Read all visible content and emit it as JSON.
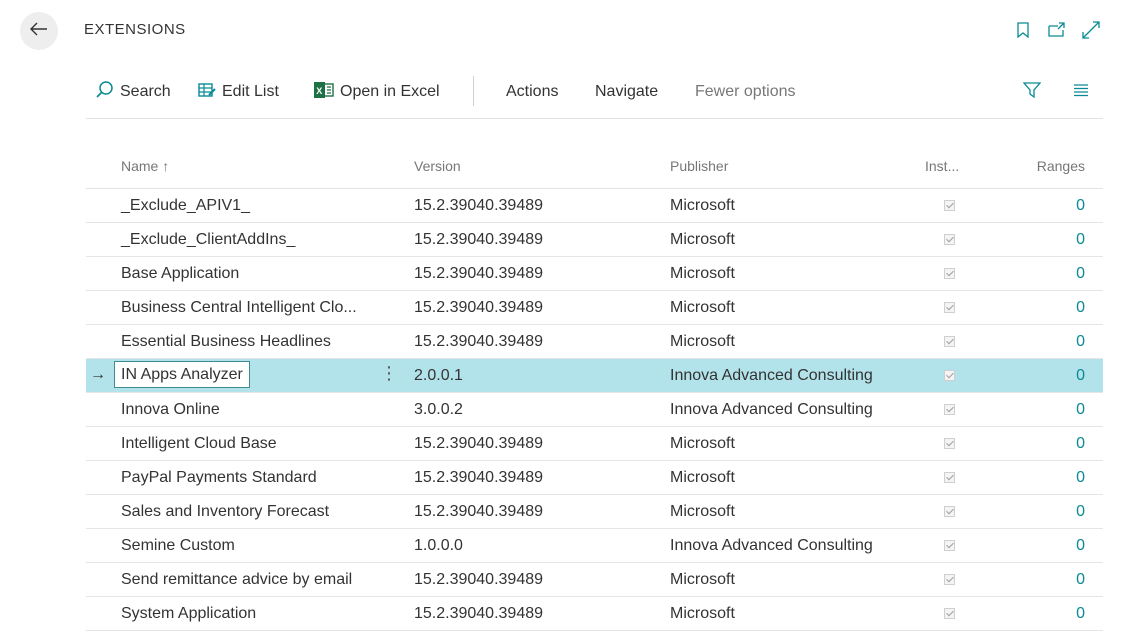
{
  "header": {
    "title": "EXTENSIONS"
  },
  "toolbar": {
    "search_label": "Search",
    "edit_list_label": "Edit List",
    "open_excel_label": "Open in Excel",
    "actions_label": "Actions",
    "navigate_label": "Navigate",
    "fewer_options_label": "Fewer options"
  },
  "columns": {
    "name": "Name ↑",
    "version": "Version",
    "publisher": "Publisher",
    "installed": "Inst...",
    "ranges": "Ranges"
  },
  "rows": [
    {
      "name": "_Exclude_APIV1_",
      "version": "15.2.39040.39489",
      "publisher": "Microsoft",
      "ranges": "0"
    },
    {
      "name": "_Exclude_ClientAddIns_",
      "version": "15.2.39040.39489",
      "publisher": "Microsoft",
      "ranges": "0"
    },
    {
      "name": "Base Application",
      "version": "15.2.39040.39489",
      "publisher": "Microsoft",
      "ranges": "0"
    },
    {
      "name": "Business Central Intelligent Clo...",
      "version": "15.2.39040.39489",
      "publisher": "Microsoft",
      "ranges": "0"
    },
    {
      "name": "Essential Business Headlines",
      "version": "15.2.39040.39489",
      "publisher": "Microsoft",
      "ranges": "0"
    },
    {
      "name": "IN Apps Analyzer",
      "version": "2.0.0.1",
      "publisher": "Innova Advanced Consulting",
      "ranges": "0"
    },
    {
      "name": "Innova Online",
      "version": "3.0.0.2",
      "publisher": "Innova Advanced Consulting",
      "ranges": "0"
    },
    {
      "name": "Intelligent Cloud Base",
      "version": "15.2.39040.39489",
      "publisher": "Microsoft",
      "ranges": "0"
    },
    {
      "name": "PayPal Payments Standard",
      "version": "15.2.39040.39489",
      "publisher": "Microsoft",
      "ranges": "0"
    },
    {
      "name": "Sales and Inventory Forecast",
      "version": "15.2.39040.39489",
      "publisher": "Microsoft",
      "ranges": "0"
    },
    {
      "name": "Semine Custom",
      "version": "1.0.0.0",
      "publisher": "Innova Advanced Consulting",
      "ranges": "0"
    },
    {
      "name": "Send remittance advice by email",
      "version": "15.2.39040.39489",
      "publisher": "Microsoft",
      "ranges": "0"
    },
    {
      "name": "System Application",
      "version": "15.2.39040.39489",
      "publisher": "Microsoft",
      "ranges": "0"
    }
  ],
  "colors": {
    "accent": "#0a8a94",
    "selected_row": "#b3e3ea",
    "excel_green": "#1e7145"
  }
}
